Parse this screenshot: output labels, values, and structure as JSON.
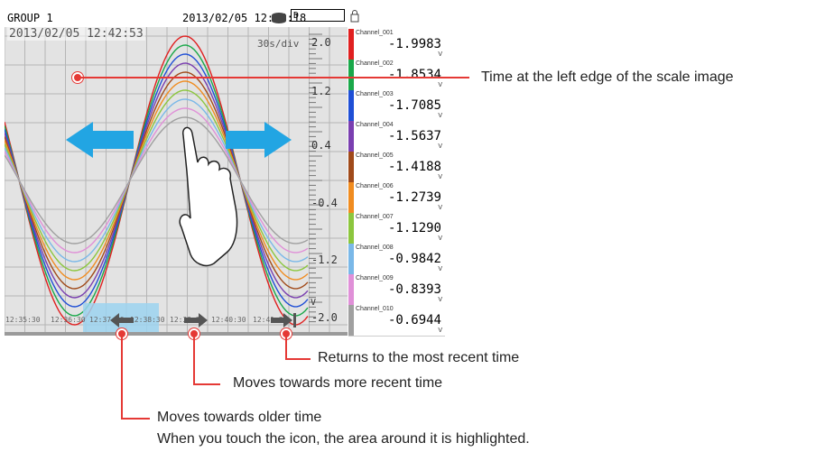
{
  "header": {
    "group": "GROUP 1",
    "datetime": "2013/02/05 12:44:18",
    "media": "D"
  },
  "trend": {
    "left_edge_time": "2013/02/05 12:42:53",
    "rate": "30s/div",
    "scale_labels": [
      "2.0",
      "1.2",
      "0.4",
      "-0.4",
      "-1.2",
      "-2.0"
    ],
    "scale_unit": "V",
    "time_ticks": [
      "12:35:30",
      "12:36:30",
      "12:37:30",
      "12:38:30",
      "12:39:30",
      "12:40:30",
      "12:41:30"
    ]
  },
  "channels": [
    {
      "name": "Channel_001",
      "value": "-1.9983",
      "unit": "V",
      "color": "#e02020"
    },
    {
      "name": "Channel_002",
      "value": "-1.8534",
      "unit": "V",
      "color": "#1aa84a"
    },
    {
      "name": "Channel_003",
      "value": "-1.7085",
      "unit": "V",
      "color": "#1f4fd6"
    },
    {
      "name": "Channel_004",
      "value": "-1.5637",
      "unit": "V",
      "color": "#7a3fb0"
    },
    {
      "name": "Channel_005",
      "value": "-1.4188",
      "unit": "V",
      "color": "#a04a1a"
    },
    {
      "name": "Channel_006",
      "value": "-1.2739",
      "unit": "V",
      "color": "#f08c20"
    },
    {
      "name": "Channel_007",
      "value": "-1.1290",
      "unit": "V",
      "color": "#8cc63e"
    },
    {
      "name": "Channel_008",
      "value": "-0.9842",
      "unit": "V",
      "color": "#7ab8e8"
    },
    {
      "name": "Channel_009",
      "value": "-0.8393",
      "unit": "V",
      "color": "#e090d8"
    },
    {
      "name": "Channel_010",
      "value": "-0.6944",
      "unit": "V",
      "color": "#a0a0a0"
    }
  ],
  "callouts": {
    "left_edge": "Time at the left edge of the scale image",
    "most_recent": "Returns to the most recent time",
    "more_recent": "Moves towards more recent time",
    "older": "Moves towards older time",
    "note": "When you touch the icon, the area around it is highlighted."
  }
}
